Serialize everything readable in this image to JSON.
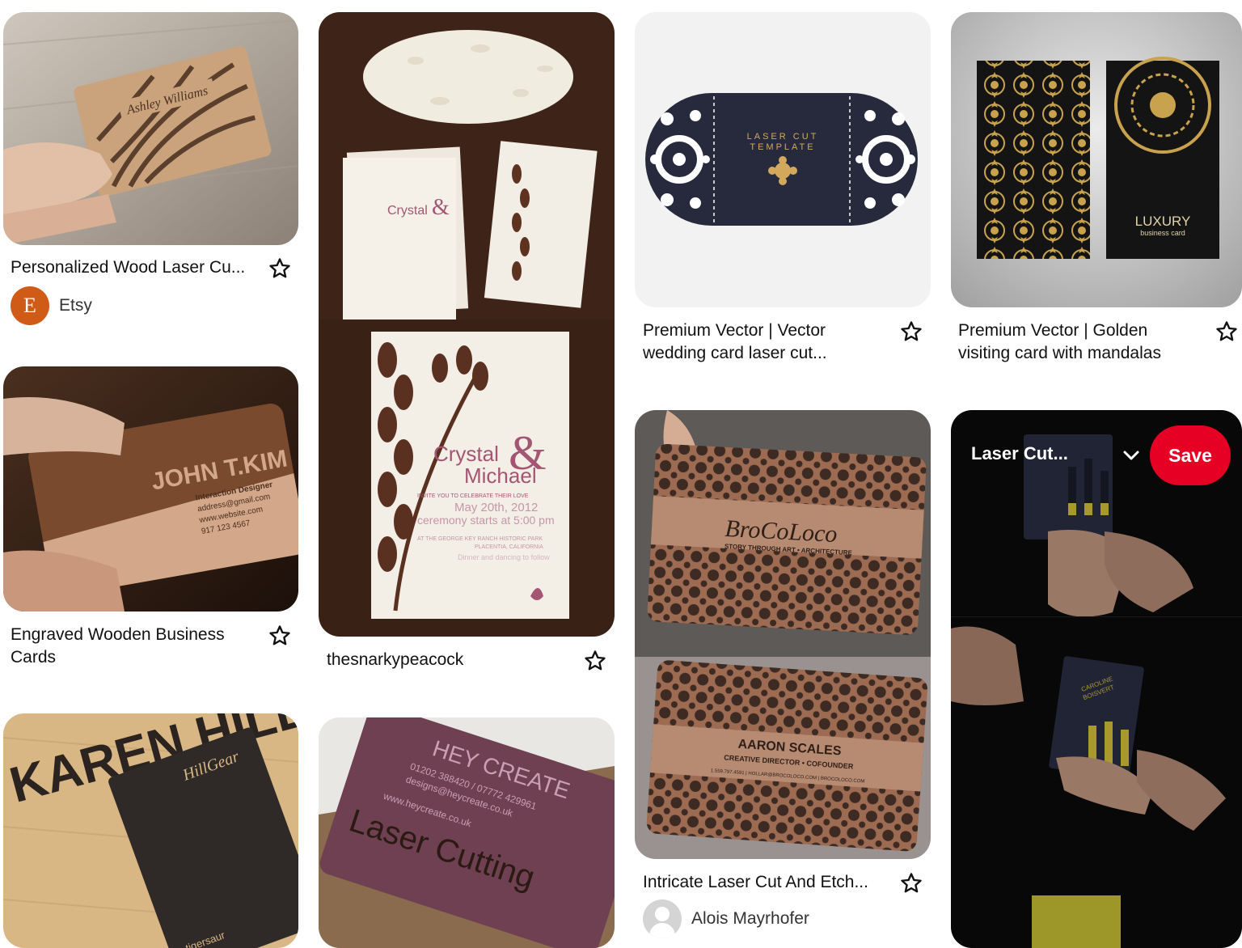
{
  "pins": [
    {
      "id": "p1",
      "title": "Personalized Wood Laser Cu...",
      "source": "Etsy",
      "avatar_letter": "E",
      "image_text": [
        "Ashley Williams"
      ]
    },
    {
      "id": "p2",
      "title": "Engraved Wooden Business Cards",
      "image_text": [
        "JOHN T.KIM",
        "Interaction Designer",
        "address@gmail.com",
        "www.website.com",
        "917 123 4567"
      ]
    },
    {
      "id": "p3",
      "image_text": [
        "KAREN HILLNET",
        "HillGear",
        "tigersaur"
      ]
    },
    {
      "id": "p4",
      "title": "thesnarkypeacock",
      "image_text": [
        "Crystal",
        "&",
        "Michael",
        "INVITE YOU TO CELEBRATE THEIR LOVE",
        "May 20th, 2012",
        "ceremony starts at 5:00 pm",
        "AT THE GEORGE KEY RANCH HISTORIC PARK",
        "PLACENTIA, CALIFORNIA",
        "Dinner and dancing to follow"
      ]
    },
    {
      "id": "p5",
      "image_text": [
        "HEY CREATE",
        "01202 388420 / 07772 429961",
        "designs@heycreate.co.uk",
        "www.heycreate.co.uk",
        "Laser Cutting"
      ]
    },
    {
      "id": "p6",
      "title": "Premium Vector | Vector wedding card laser cut...",
      "image_text": [
        "LASER CUT",
        "TEMPLATE"
      ]
    },
    {
      "id": "p7",
      "title": "Intricate Laser Cut And Etch...",
      "source": "Alois Mayrhofer",
      "image_text": [
        "BroCoLoco",
        "STORY THROUGH ART • ARCHITECTURE",
        "AARON SCALES",
        "CREATIVE DIRECTOR • COFOUNDER",
        "1.559.797.4591 | HOLLAR@BROCOLOCO.COM | BROCOLOCO.COM"
      ]
    },
    {
      "id": "p8",
      "title": "Premium Vector | Golden visiting card with mandalas",
      "image_text": [
        "LUXURY",
        "business card"
      ]
    },
    {
      "id": "p9",
      "overlay_title": "Laser Cut...",
      "save_label": "Save",
      "image_text": [
        "CAROLINE",
        "BOISVERT"
      ]
    }
  ],
  "colors": {
    "save": "#e60023",
    "etsy_avatar": "#d05b17",
    "text": "#111111"
  },
  "icons": {
    "save_pin": "star-outline-icon",
    "board_selector": "chevron-down-icon"
  }
}
